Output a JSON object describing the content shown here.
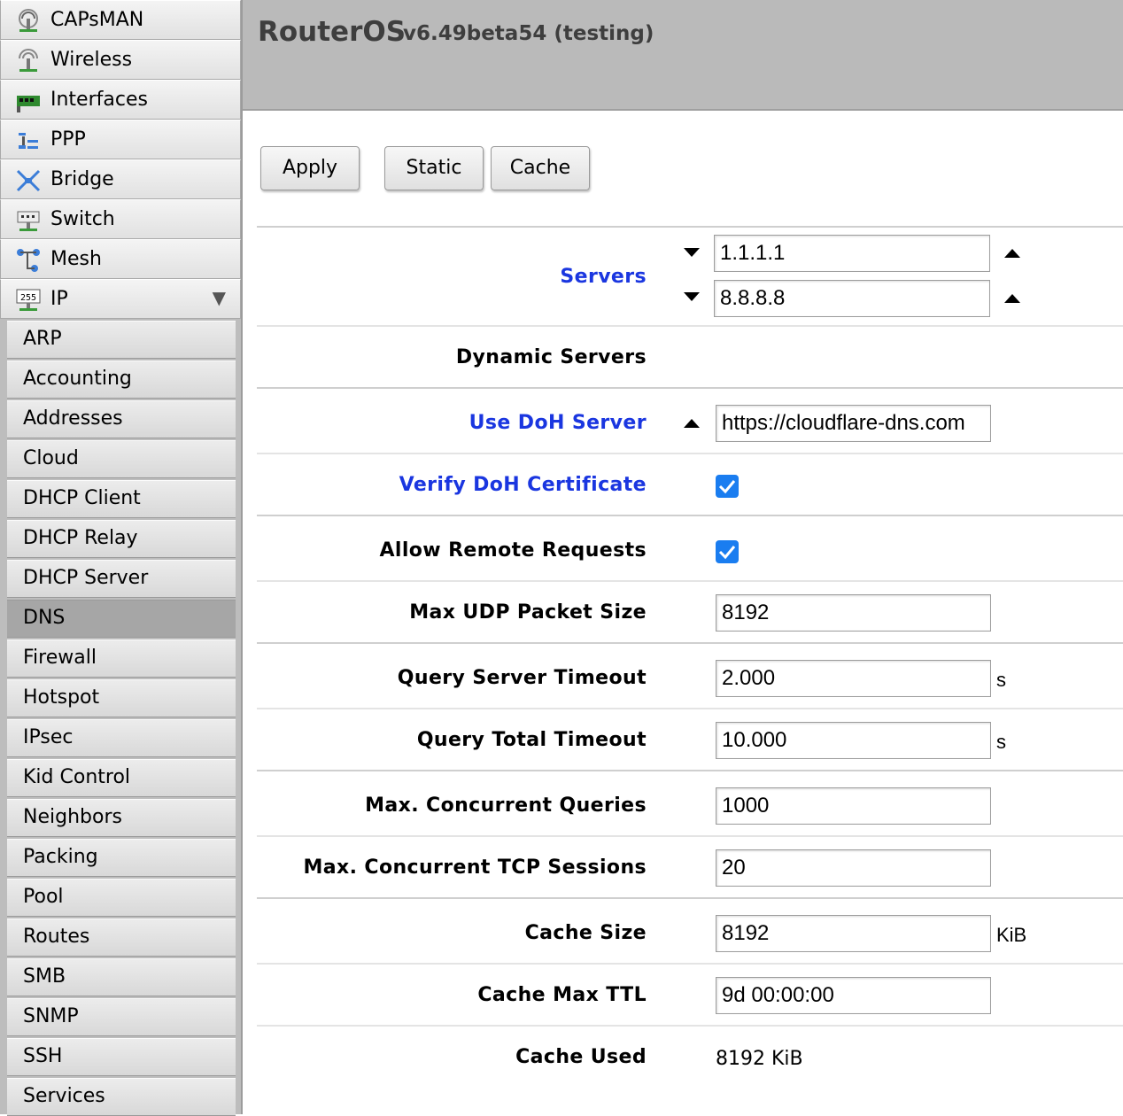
{
  "app": {
    "name": "RouterOS",
    "version": "v6.49beta54 (testing)"
  },
  "sidebar": {
    "items": [
      {
        "label": "CAPsMAN",
        "icon": "capsman-icon"
      },
      {
        "label": "Wireless",
        "icon": "wireless-icon"
      },
      {
        "label": "Interfaces",
        "icon": "interfaces-icon"
      },
      {
        "label": "PPP",
        "icon": "ppp-icon"
      },
      {
        "label": "Bridge",
        "icon": "bridge-icon"
      },
      {
        "label": "Switch",
        "icon": "switch-icon"
      },
      {
        "label": "Mesh",
        "icon": "mesh-icon"
      },
      {
        "label": "IP",
        "icon": "ip-icon",
        "expanded": true
      }
    ],
    "ip_submenu": [
      {
        "label": "ARP"
      },
      {
        "label": "Accounting"
      },
      {
        "label": "Addresses"
      },
      {
        "label": "Cloud"
      },
      {
        "label": "DHCP Client"
      },
      {
        "label": "DHCP Relay"
      },
      {
        "label": "DHCP Server"
      },
      {
        "label": "DNS",
        "active": true
      },
      {
        "label": "Firewall"
      },
      {
        "label": "Hotspot"
      },
      {
        "label": "IPsec"
      },
      {
        "label": "Kid Control"
      },
      {
        "label": "Neighbors"
      },
      {
        "label": "Packing"
      },
      {
        "label": "Pool"
      },
      {
        "label": "Routes"
      },
      {
        "label": "SMB"
      },
      {
        "label": "SNMP"
      },
      {
        "label": "SSH"
      },
      {
        "label": "Services"
      }
    ]
  },
  "toolbar": {
    "apply_label": "Apply",
    "static_label": "Static",
    "cache_label": "Cache"
  },
  "form": {
    "servers": {
      "label": "Servers",
      "values": [
        "1.1.1.1",
        "8.8.8.8"
      ]
    },
    "dynamic_servers": {
      "label": "Dynamic Servers"
    },
    "use_doh_server": {
      "label": "Use DoH Server",
      "value": "https://cloudflare-dns.com"
    },
    "verify_doh_certificate": {
      "label": "Verify DoH Certificate",
      "checked": true
    },
    "allow_remote_requests": {
      "label": "Allow Remote Requests",
      "checked": true
    },
    "max_udp_packet_size": {
      "label": "Max UDP Packet Size",
      "value": "8192"
    },
    "query_server_timeout": {
      "label": "Query Server Timeout",
      "value": "2.000",
      "unit": "s"
    },
    "query_total_timeout": {
      "label": "Query Total Timeout",
      "value": "10.000",
      "unit": "s"
    },
    "max_concurrent_queries": {
      "label": "Max. Concurrent Queries",
      "value": "1000"
    },
    "max_concurrent_tcp_sessions": {
      "label": "Max. Concurrent TCP Sessions",
      "value": "20"
    },
    "cache_size": {
      "label": "Cache Size",
      "value": "8192",
      "unit": "KiB"
    },
    "cache_max_ttl": {
      "label": "Cache Max TTL",
      "value": "9d 00:00:00"
    },
    "cache_used": {
      "label": "Cache Used",
      "value": "8192 KiB"
    }
  },
  "colors": {
    "link_label": "#1a36e0",
    "checkbox": "#1a7df0",
    "header_bg": "#bababa"
  }
}
